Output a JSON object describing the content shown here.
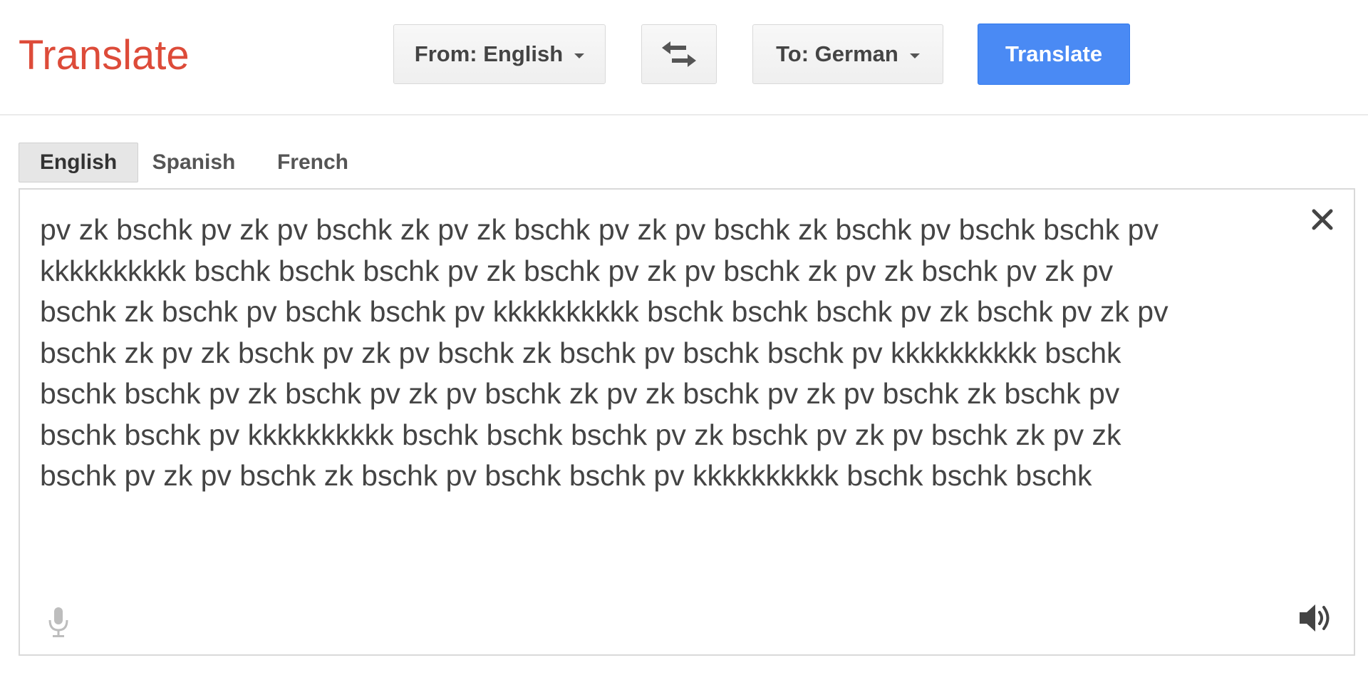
{
  "app": {
    "title": "Translate"
  },
  "toolbar": {
    "from_label": "From: English",
    "swap_icon": "swap-arrows-icon",
    "to_label": "To: German",
    "translate_label": "Translate"
  },
  "source_tabs": [
    {
      "label": "English",
      "active": true
    },
    {
      "label": "Spanish",
      "active": false
    },
    {
      "label": "French",
      "active": false
    }
  ],
  "source_text": {
    "lines": [
      "pv zk bschk pv zk pv bschk zk pv zk bschk pv zk pv bschk zk bschk pv bschk bschk pv",
      "kkkkkkkkkk bschk bschk bschk pv zk bschk pv zk pv bschk zk pv zk bschk pv zk pv",
      "bschk zk bschk pv bschk bschk pv kkkkkkkkkk bschk bschk bschk pv zk bschk pv zk pv",
      "bschk zk pv zk bschk pv zk pv bschk zk bschk pv bschk bschk pv kkkkkkkkkk bschk",
      "bschk bschk pv zk bschk pv zk pv bschk zk pv zk bschk pv zk pv bschk zk bschk pv",
      "bschk bschk pv kkkkkkkkkk bschk bschk bschk pv zk bschk pv zk pv bschk zk pv zk",
      "bschk pv zk pv bschk zk bschk pv bschk bschk pv kkkkkkkkkk bschk bschk bschk"
    ]
  },
  "icons": {
    "clear": "close-icon",
    "microphone": "microphone-icon",
    "listen": "speaker-icon"
  },
  "colors": {
    "logo": "#dd4b39",
    "translate_button": "#4a8af4",
    "text": "#444444"
  }
}
